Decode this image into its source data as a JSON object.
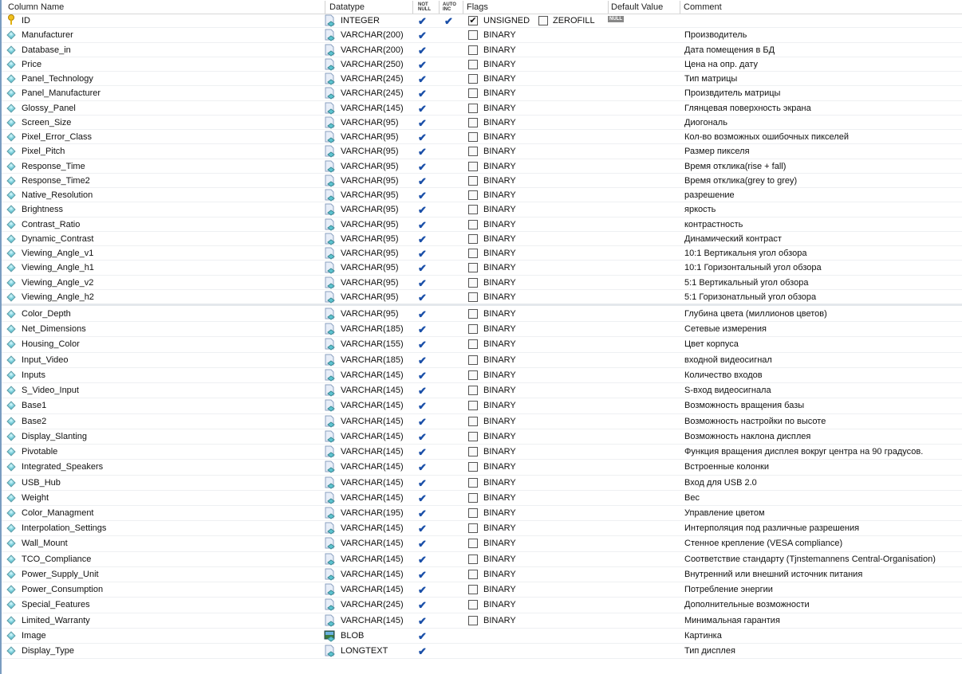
{
  "header": {
    "column_name": "Column Name",
    "datatype": "Datatype",
    "not_null": "NOT NULL",
    "auto_inc": "AUTO INC",
    "flags": "Flags",
    "default_value": "Default Value",
    "comment": "Comment"
  },
  "flag_labels": {
    "unsigned": "UNSIGNED",
    "zerofill": "ZEROFILL",
    "binary": "BINARY",
    "null_badge": "NULL"
  },
  "colors": {
    "check": "#1a4fa8",
    "accent": "#7a9cc0"
  },
  "rows": [
    {
      "name": "ID",
      "type": "INTEGER",
      "not_null": true,
      "auto_inc": true,
      "pk": true,
      "flags": "int",
      "comment": ""
    },
    {
      "name": "Manufacturer",
      "type": "VARCHAR(200)",
      "not_null": true,
      "flags": "binary",
      "comment": "Производитель"
    },
    {
      "name": "Database_in",
      "type": "VARCHAR(200)",
      "not_null": true,
      "flags": "binary",
      "comment": "Дата помещения в БД"
    },
    {
      "name": "Price",
      "type": "VARCHAR(250)",
      "not_null": true,
      "flags": "binary",
      "comment": "Цена на опр. дату"
    },
    {
      "name": "Panel_Technology",
      "type": "VARCHAR(245)",
      "not_null": true,
      "flags": "binary",
      "comment": "Тип матрицы"
    },
    {
      "name": "Panel_Manufacturer",
      "type": "VARCHAR(245)",
      "not_null": true,
      "flags": "binary",
      "comment": "Произвдитель матрицы"
    },
    {
      "name": "Glossy_Panel",
      "type": "VARCHAR(145)",
      "not_null": true,
      "flags": "binary",
      "comment": "Глянцевая поверхность экрана"
    },
    {
      "name": "Screen_Size",
      "type": "VARCHAR(95)",
      "not_null": true,
      "flags": "binary",
      "comment": "Диогональ"
    },
    {
      "name": "Pixel_Error_Class",
      "type": "VARCHAR(95)",
      "not_null": true,
      "flags": "binary",
      "comment": "Кол-во возможных ошибочных пикселей"
    },
    {
      "name": "Pixel_Pitch",
      "type": "VARCHAR(95)",
      "not_null": true,
      "flags": "binary",
      "comment": "Размер пикселя"
    },
    {
      "name": "Response_Time",
      "type": "VARCHAR(95)",
      "not_null": true,
      "flags": "binary",
      "comment": "Время отклика(rise + fall)"
    },
    {
      "name": "Response_Time2",
      "type": "VARCHAR(95)",
      "not_null": true,
      "flags": "binary",
      "comment": "Время отклика(grey to grey)"
    },
    {
      "name": "Native_Resolution",
      "type": "VARCHAR(95)",
      "not_null": true,
      "flags": "binary",
      "comment": "разрешение"
    },
    {
      "name": "Brightness",
      "type": "VARCHAR(95)",
      "not_null": true,
      "flags": "binary",
      "comment": "яркость"
    },
    {
      "name": "Contrast_Ratio",
      "type": "VARCHAR(95)",
      "not_null": true,
      "flags": "binary",
      "comment": "контрастность"
    },
    {
      "name": "Dynamic_Contrast",
      "type": "VARCHAR(95)",
      "not_null": true,
      "flags": "binary",
      "comment": "Динамический контраст"
    },
    {
      "name": "Viewing_Angle_v1",
      "type": "VARCHAR(95)",
      "not_null": true,
      "flags": "binary",
      "comment": "10:1 Вертикальня угол обзора"
    },
    {
      "name": "Viewing_Angle_h1",
      "type": "VARCHAR(95)",
      "not_null": true,
      "flags": "binary",
      "comment": "10:1 Горизонтальный угол обзора"
    },
    {
      "name": "Viewing_Angle_v2",
      "type": "VARCHAR(95)",
      "not_null": true,
      "flags": "binary",
      "comment": "5:1 Вертикальный угол обзора"
    },
    {
      "name": "Viewing_Angle_h2",
      "type": "VARCHAR(95)",
      "not_null": true,
      "flags": "binary",
      "comment": "5:1 Горизонатльный угол обзора"
    },
    {
      "name": "Color_Depth",
      "type": "VARCHAR(95)",
      "not_null": true,
      "flags": "binary",
      "comment": "Глубина цвета (миллионов цветов)"
    },
    {
      "name": "Net_Dimensions",
      "type": "VARCHAR(185)",
      "not_null": true,
      "flags": "binary",
      "comment": "Сетевые измерения"
    },
    {
      "name": "Housing_Color",
      "type": "VARCHAR(155)",
      "not_null": true,
      "flags": "binary",
      "comment": "Цвет корпуса"
    },
    {
      "name": "Input_Video",
      "type": "VARCHAR(185)",
      "not_null": true,
      "flags": "binary",
      "comment": "входной видеосигнал"
    },
    {
      "name": "Inputs",
      "type": "VARCHAR(145)",
      "not_null": true,
      "flags": "binary",
      "comment": "Количество входов"
    },
    {
      "name": "S_Video_Input",
      "type": "VARCHAR(145)",
      "not_null": true,
      "flags": "binary",
      "comment": "S-вход видеосигнала"
    },
    {
      "name": "Base1",
      "type": "VARCHAR(145)",
      "not_null": true,
      "flags": "binary",
      "comment": "Возможность вращения базы"
    },
    {
      "name": "Base2",
      "type": "VARCHAR(145)",
      "not_null": true,
      "flags": "binary",
      "comment": "Возможность настройки по высоте"
    },
    {
      "name": "Display_Slanting",
      "type": "VARCHAR(145)",
      "not_null": true,
      "flags": "binary",
      "comment": "Возможность наклона дисплея"
    },
    {
      "name": "Pivotable",
      "type": "VARCHAR(145)",
      "not_null": true,
      "flags": "binary",
      "comment": "Функция вращения дисплея вокруг центра на 90 градусов."
    },
    {
      "name": "Integrated_Speakers",
      "type": "VARCHAR(145)",
      "not_null": true,
      "flags": "binary",
      "comment": "Встроенные колонки"
    },
    {
      "name": "USB_Hub",
      "type": "VARCHAR(145)",
      "not_null": true,
      "flags": "binary",
      "comment": "Вход для USB 2.0"
    },
    {
      "name": "Weight",
      "type": "VARCHAR(145)",
      "not_null": true,
      "flags": "binary",
      "comment": "Вес"
    },
    {
      "name": "Color_Managment",
      "type": "VARCHAR(195)",
      "not_null": true,
      "flags": "binary",
      "comment": "Управление цветом"
    },
    {
      "name": "Interpolation_Settings",
      "type": "VARCHAR(145)",
      "not_null": true,
      "flags": "binary",
      "comment": "Интерполяция под различные разрешения"
    },
    {
      "name": "Wall_Mount",
      "type": "VARCHAR(145)",
      "not_null": true,
      "flags": "binary",
      "comment": "Стенное крепление (VESA compliance)"
    },
    {
      "name": "TCO_Compliance",
      "type": "VARCHAR(145)",
      "not_null": true,
      "flags": "binary",
      "comment": "Соответствие стандарту (Tjnstemannens Central-Organisation)"
    },
    {
      "name": "Power_Supply_Unit",
      "type": "VARCHAR(145)",
      "not_null": true,
      "flags": "binary",
      "comment": "Внутренний или внешний источник питания"
    },
    {
      "name": "Power_Consumption",
      "type": "VARCHAR(145)",
      "not_null": true,
      "flags": "binary",
      "comment": "Потребление энергии"
    },
    {
      "name": "Special_Features",
      "type": "VARCHAR(245)",
      "not_null": true,
      "flags": "binary",
      "comment": "Дополнительные возможности"
    },
    {
      "name": "Limited_Warranty",
      "type": "VARCHAR(145)",
      "not_null": true,
      "flags": "binary",
      "comment": "Минимальная гарантия"
    },
    {
      "name": "Image",
      "type": "BLOB",
      "not_null": true,
      "flags": "none",
      "blob": true,
      "comment": "Картинка"
    },
    {
      "name": "Display_Type",
      "type": "LONGTEXT",
      "not_null": true,
      "flags": "none",
      "comment": "Тип дисплея"
    }
  ]
}
